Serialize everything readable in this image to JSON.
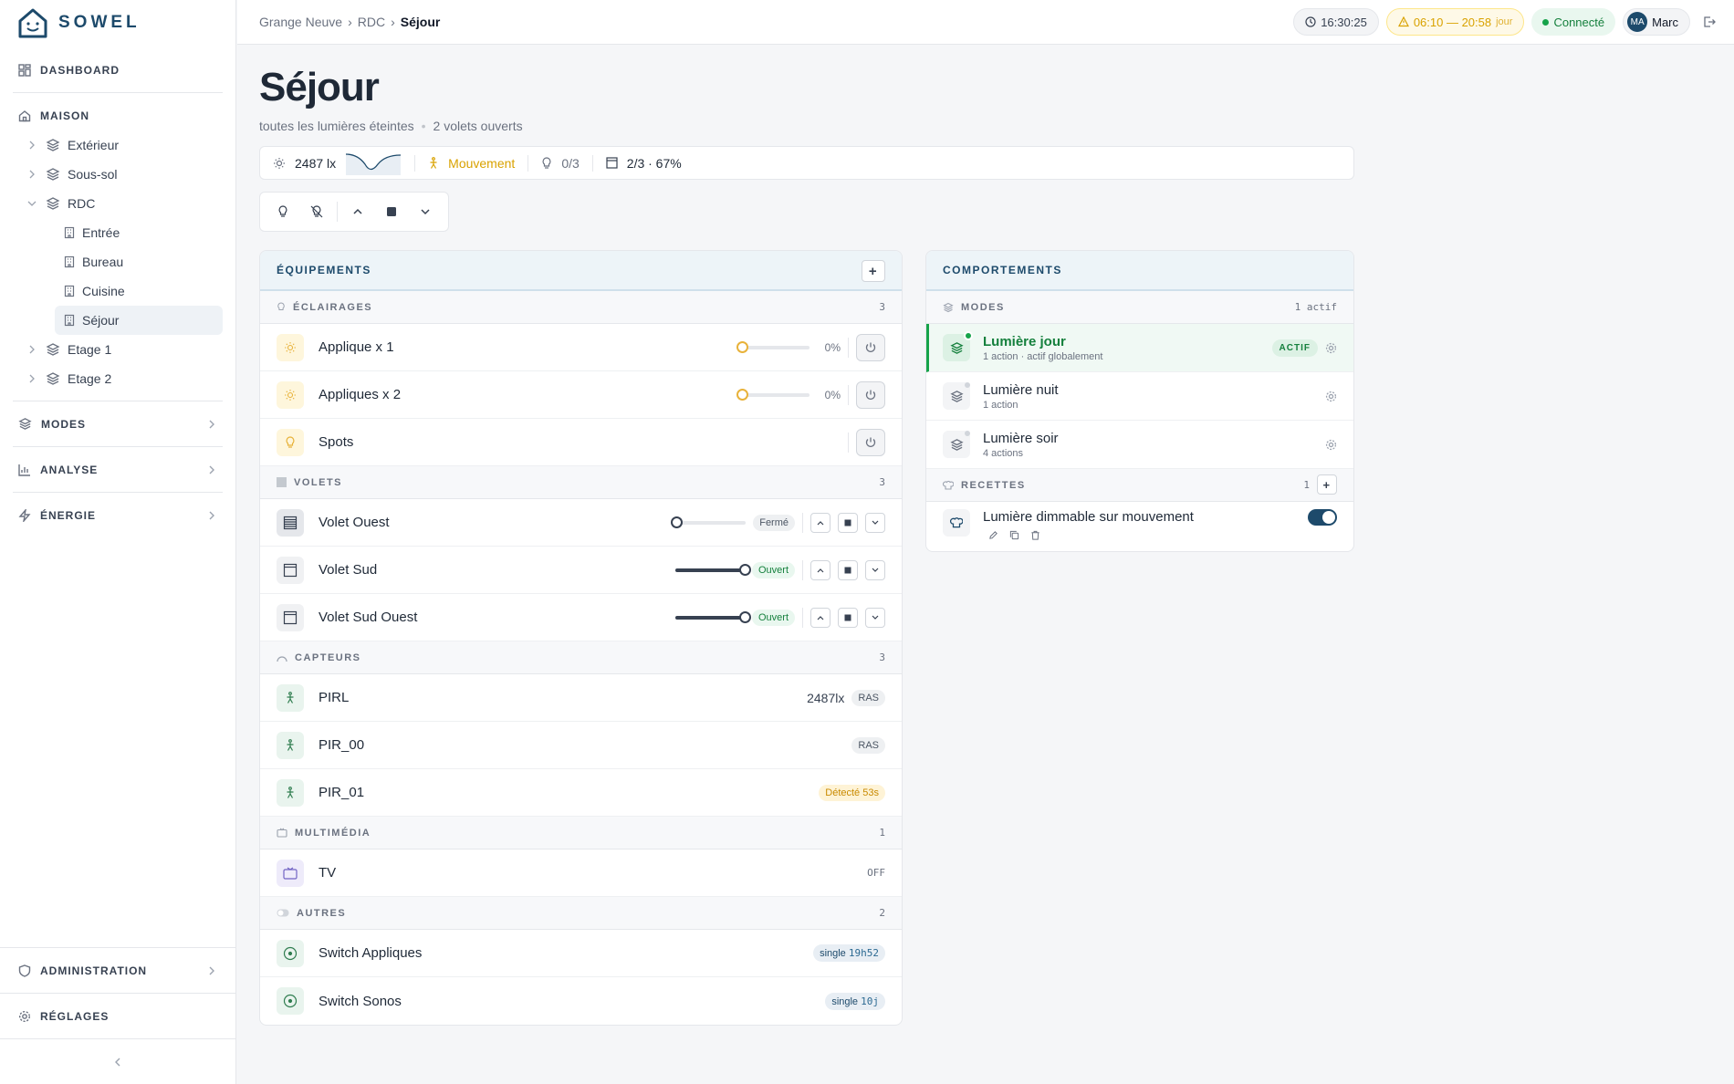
{
  "brand": {
    "name": "SOWEL"
  },
  "sidebar": {
    "dashboard": "DASHBOARD",
    "maison": "MAISON",
    "tree": [
      {
        "label": "Extérieur",
        "level": 1
      },
      {
        "label": "Sous-sol",
        "level": 1
      },
      {
        "label": "RDC",
        "level": 1,
        "expanded": true
      },
      {
        "label": "Entrée",
        "level": 2
      },
      {
        "label": "Bureau",
        "level": 2
      },
      {
        "label": "Cuisine",
        "level": 2
      },
      {
        "label": "Séjour",
        "level": 2,
        "active": true
      },
      {
        "label": "Etage 1",
        "level": 1
      },
      {
        "label": "Etage 2",
        "level": 1
      }
    ],
    "modes": "MODES",
    "analyse": "ANALYSE",
    "energie": "ÉNERGIE",
    "administration": "ADMINISTRATION",
    "reglages": "RÉGLAGES"
  },
  "header": {
    "breadcrumb": [
      "Grange Neuve",
      "RDC",
      "Séjour"
    ],
    "time": "16:30:25",
    "sun_range": "06:10 — 20:58",
    "sun_label": "jour",
    "status": "Connecté",
    "user_initials": "MA",
    "user_name": "Marc"
  },
  "page": {
    "title": "Séjour",
    "subtitle_1": "toutes les lumières éteintes",
    "subtitle_2": "2 volets ouverts",
    "stats": {
      "lux": "2487 lx",
      "motion": "Mouvement",
      "lights": "0/3",
      "shutters": "2/3 · 67%"
    }
  },
  "equipements": {
    "title": "ÉQUIPEMENTS",
    "categories": {
      "eclairages": {
        "label": "ÉCLAIRAGES",
        "count": "3"
      },
      "volets": {
        "label": "VOLETS",
        "count": "3"
      },
      "capteurs": {
        "label": "CAPTEURS",
        "count": "3"
      },
      "multimedia": {
        "label": "MULTIMÉDIA",
        "count": "1"
      },
      "autres": {
        "label": "AUTRES",
        "count": "2"
      }
    },
    "lights": [
      {
        "name": "Applique x 1",
        "pct": "0%",
        "level": 0
      },
      {
        "name": "Appliques x 2",
        "pct": "0%",
        "level": 0
      },
      {
        "name": "Spots"
      }
    ],
    "shutters": [
      {
        "name": "Volet Ouest",
        "state": "Fermé",
        "level": 0
      },
      {
        "name": "Volet Sud",
        "state": "Ouvert",
        "level": 100
      },
      {
        "name": "Volet Sud Ouest",
        "state": "Ouvert",
        "level": 100
      }
    ],
    "sensors": [
      {
        "name": "PIRL",
        "value": "2487lx",
        "state": "RAS"
      },
      {
        "name": "PIR_00",
        "state": "RAS"
      },
      {
        "name": "PIR_01",
        "state": "Détecté",
        "age": "53s"
      }
    ],
    "media": [
      {
        "name": "TV",
        "state": "OFF"
      }
    ],
    "others": [
      {
        "name": "Switch Appliques",
        "action": "single",
        "time": "19h52"
      },
      {
        "name": "Switch Sonos",
        "action": "single",
        "time": "10j"
      }
    ]
  },
  "comportements": {
    "title": "COMPORTEMENTS",
    "modes_label": "MODES",
    "modes_count": "1 actif",
    "modes": [
      {
        "name": "Lumière jour",
        "sub": "1 action",
        "sub2": " · actif globalement",
        "badge": "ACTIF"
      },
      {
        "name": "Lumière nuit",
        "sub": "1 action"
      },
      {
        "name": "Lumière soir",
        "sub": "4 actions"
      }
    ],
    "recettes_label": "RECETTES",
    "recettes_count": "1",
    "recettes": [
      {
        "name": "Lumière dimmable sur mouvement",
        "enabled": true
      }
    ]
  },
  "colors": {
    "brand": "#1d4a6b",
    "active_green": "#16a34a",
    "warn": "#d9a200"
  }
}
